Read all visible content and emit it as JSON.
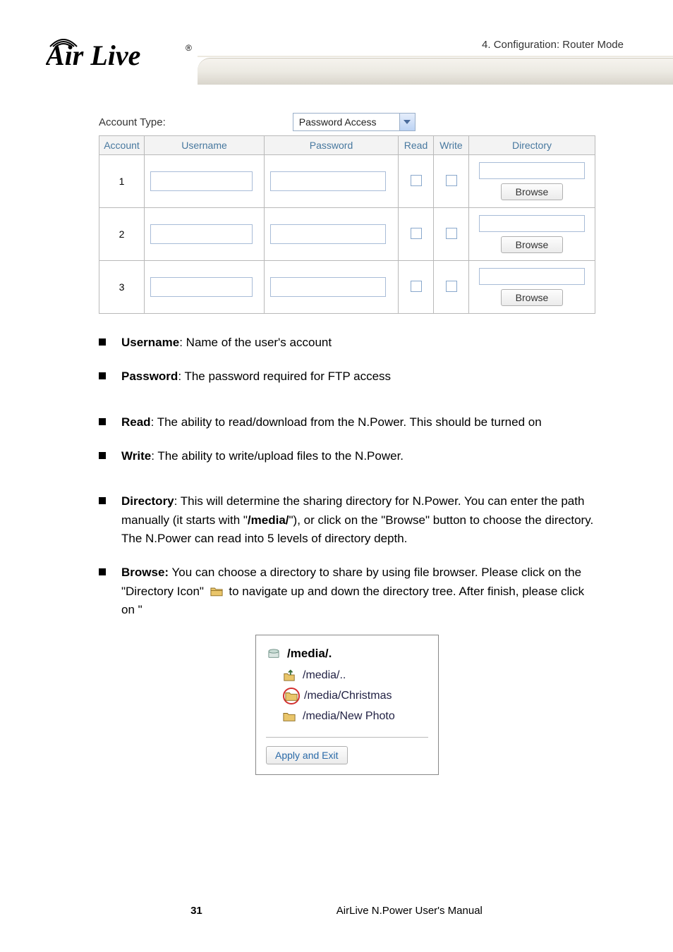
{
  "header": {
    "breadcrumb": "4. Configuration: Router Mode",
    "logo_text": "Air Live",
    "logo_r": "®"
  },
  "table": {
    "account_type_label": "Account Type:",
    "account_type_value": "Password Access",
    "headers": {
      "account": "Account",
      "username": "Username",
      "password": "Password",
      "read": "Read",
      "write": "Write",
      "directory": "Directory"
    },
    "rows": [
      {
        "idx": "1",
        "browse": "Browse"
      },
      {
        "idx": "2",
        "browse": "Browse"
      },
      {
        "idx": "3",
        "browse": "Browse"
      }
    ]
  },
  "bullets": {
    "username_lbl": "Username",
    "username_txt": ":   Name of the user's account",
    "password_lbl": "Password",
    "password_txt": ":   The password required for FTP access",
    "read_lbl": "Read",
    "read_txt": ": The ability to read/download from the N.Power.    This should be turned on",
    "write_lbl": "Write",
    "write_txt": ": The ability to write/upload files to the N.Power.",
    "dir_lbl": "Directory",
    "dir_txt_a": ":   This will determine the sharing directory for N.Power.    You can enter the path manually (it starts with \"",
    "dir_media": "/media/",
    "dir_txt_b": "\"), or click on the \"Browse\" button to choose the directory.    The N.Power can read into 5 levels of directory depth.",
    "browse_lbl": "Browse:",
    "browse_txt_a": " You can choose a directory to share by using file browser.    Please click on the \"Directory Icon\"  ",
    "browse_txt_b": "  to navigate up and down the directory tree.  After finish, please click on \""
  },
  "browser": {
    "root": "/media/.",
    "up": "/media/..",
    "item1": "/media/Christmas",
    "item2": "/media/New Photo",
    "apply": "Apply and Exit"
  },
  "footer": {
    "page": "31",
    "manual": "AirLive N.Power User's Manual"
  }
}
